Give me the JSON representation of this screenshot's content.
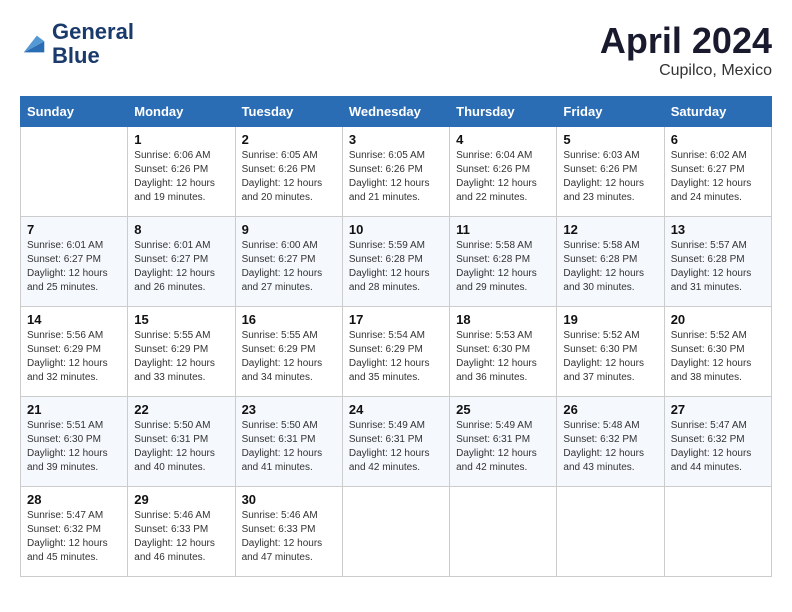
{
  "header": {
    "logo_line1": "General",
    "logo_line2": "Blue",
    "month_year": "April 2024",
    "location": "Cupilco, Mexico"
  },
  "days_of_week": [
    "Sunday",
    "Monday",
    "Tuesday",
    "Wednesday",
    "Thursday",
    "Friday",
    "Saturday"
  ],
  "weeks": [
    [
      {
        "day": "",
        "info": ""
      },
      {
        "day": "1",
        "info": "Sunrise: 6:06 AM\nSunset: 6:26 PM\nDaylight: 12 hours\nand 19 minutes."
      },
      {
        "day": "2",
        "info": "Sunrise: 6:05 AM\nSunset: 6:26 PM\nDaylight: 12 hours\nand 20 minutes."
      },
      {
        "day": "3",
        "info": "Sunrise: 6:05 AM\nSunset: 6:26 PM\nDaylight: 12 hours\nand 21 minutes."
      },
      {
        "day": "4",
        "info": "Sunrise: 6:04 AM\nSunset: 6:26 PM\nDaylight: 12 hours\nand 22 minutes."
      },
      {
        "day": "5",
        "info": "Sunrise: 6:03 AM\nSunset: 6:26 PM\nDaylight: 12 hours\nand 23 minutes."
      },
      {
        "day": "6",
        "info": "Sunrise: 6:02 AM\nSunset: 6:27 PM\nDaylight: 12 hours\nand 24 minutes."
      }
    ],
    [
      {
        "day": "7",
        "info": "Sunrise: 6:01 AM\nSunset: 6:27 PM\nDaylight: 12 hours\nand 25 minutes."
      },
      {
        "day": "8",
        "info": "Sunrise: 6:01 AM\nSunset: 6:27 PM\nDaylight: 12 hours\nand 26 minutes."
      },
      {
        "day": "9",
        "info": "Sunrise: 6:00 AM\nSunset: 6:27 PM\nDaylight: 12 hours\nand 27 minutes."
      },
      {
        "day": "10",
        "info": "Sunrise: 5:59 AM\nSunset: 6:28 PM\nDaylight: 12 hours\nand 28 minutes."
      },
      {
        "day": "11",
        "info": "Sunrise: 5:58 AM\nSunset: 6:28 PM\nDaylight: 12 hours\nand 29 minutes."
      },
      {
        "day": "12",
        "info": "Sunrise: 5:58 AM\nSunset: 6:28 PM\nDaylight: 12 hours\nand 30 minutes."
      },
      {
        "day": "13",
        "info": "Sunrise: 5:57 AM\nSunset: 6:28 PM\nDaylight: 12 hours\nand 31 minutes."
      }
    ],
    [
      {
        "day": "14",
        "info": "Sunrise: 5:56 AM\nSunset: 6:29 PM\nDaylight: 12 hours\nand 32 minutes."
      },
      {
        "day": "15",
        "info": "Sunrise: 5:55 AM\nSunset: 6:29 PM\nDaylight: 12 hours\nand 33 minutes."
      },
      {
        "day": "16",
        "info": "Sunrise: 5:55 AM\nSunset: 6:29 PM\nDaylight: 12 hours\nand 34 minutes."
      },
      {
        "day": "17",
        "info": "Sunrise: 5:54 AM\nSunset: 6:29 PM\nDaylight: 12 hours\nand 35 minutes."
      },
      {
        "day": "18",
        "info": "Sunrise: 5:53 AM\nSunset: 6:30 PM\nDaylight: 12 hours\nand 36 minutes."
      },
      {
        "day": "19",
        "info": "Sunrise: 5:52 AM\nSunset: 6:30 PM\nDaylight: 12 hours\nand 37 minutes."
      },
      {
        "day": "20",
        "info": "Sunrise: 5:52 AM\nSunset: 6:30 PM\nDaylight: 12 hours\nand 38 minutes."
      }
    ],
    [
      {
        "day": "21",
        "info": "Sunrise: 5:51 AM\nSunset: 6:30 PM\nDaylight: 12 hours\nand 39 minutes."
      },
      {
        "day": "22",
        "info": "Sunrise: 5:50 AM\nSunset: 6:31 PM\nDaylight: 12 hours\nand 40 minutes."
      },
      {
        "day": "23",
        "info": "Sunrise: 5:50 AM\nSunset: 6:31 PM\nDaylight: 12 hours\nand 41 minutes."
      },
      {
        "day": "24",
        "info": "Sunrise: 5:49 AM\nSunset: 6:31 PM\nDaylight: 12 hours\nand 42 minutes."
      },
      {
        "day": "25",
        "info": "Sunrise: 5:49 AM\nSunset: 6:31 PM\nDaylight: 12 hours\nand 42 minutes."
      },
      {
        "day": "26",
        "info": "Sunrise: 5:48 AM\nSunset: 6:32 PM\nDaylight: 12 hours\nand 43 minutes."
      },
      {
        "day": "27",
        "info": "Sunrise: 5:47 AM\nSunset: 6:32 PM\nDaylight: 12 hours\nand 44 minutes."
      }
    ],
    [
      {
        "day": "28",
        "info": "Sunrise: 5:47 AM\nSunset: 6:32 PM\nDaylight: 12 hours\nand 45 minutes."
      },
      {
        "day": "29",
        "info": "Sunrise: 5:46 AM\nSunset: 6:33 PM\nDaylight: 12 hours\nand 46 minutes."
      },
      {
        "day": "30",
        "info": "Sunrise: 5:46 AM\nSunset: 6:33 PM\nDaylight: 12 hours\nand 47 minutes."
      },
      {
        "day": "",
        "info": ""
      },
      {
        "day": "",
        "info": ""
      },
      {
        "day": "",
        "info": ""
      },
      {
        "day": "",
        "info": ""
      }
    ]
  ]
}
